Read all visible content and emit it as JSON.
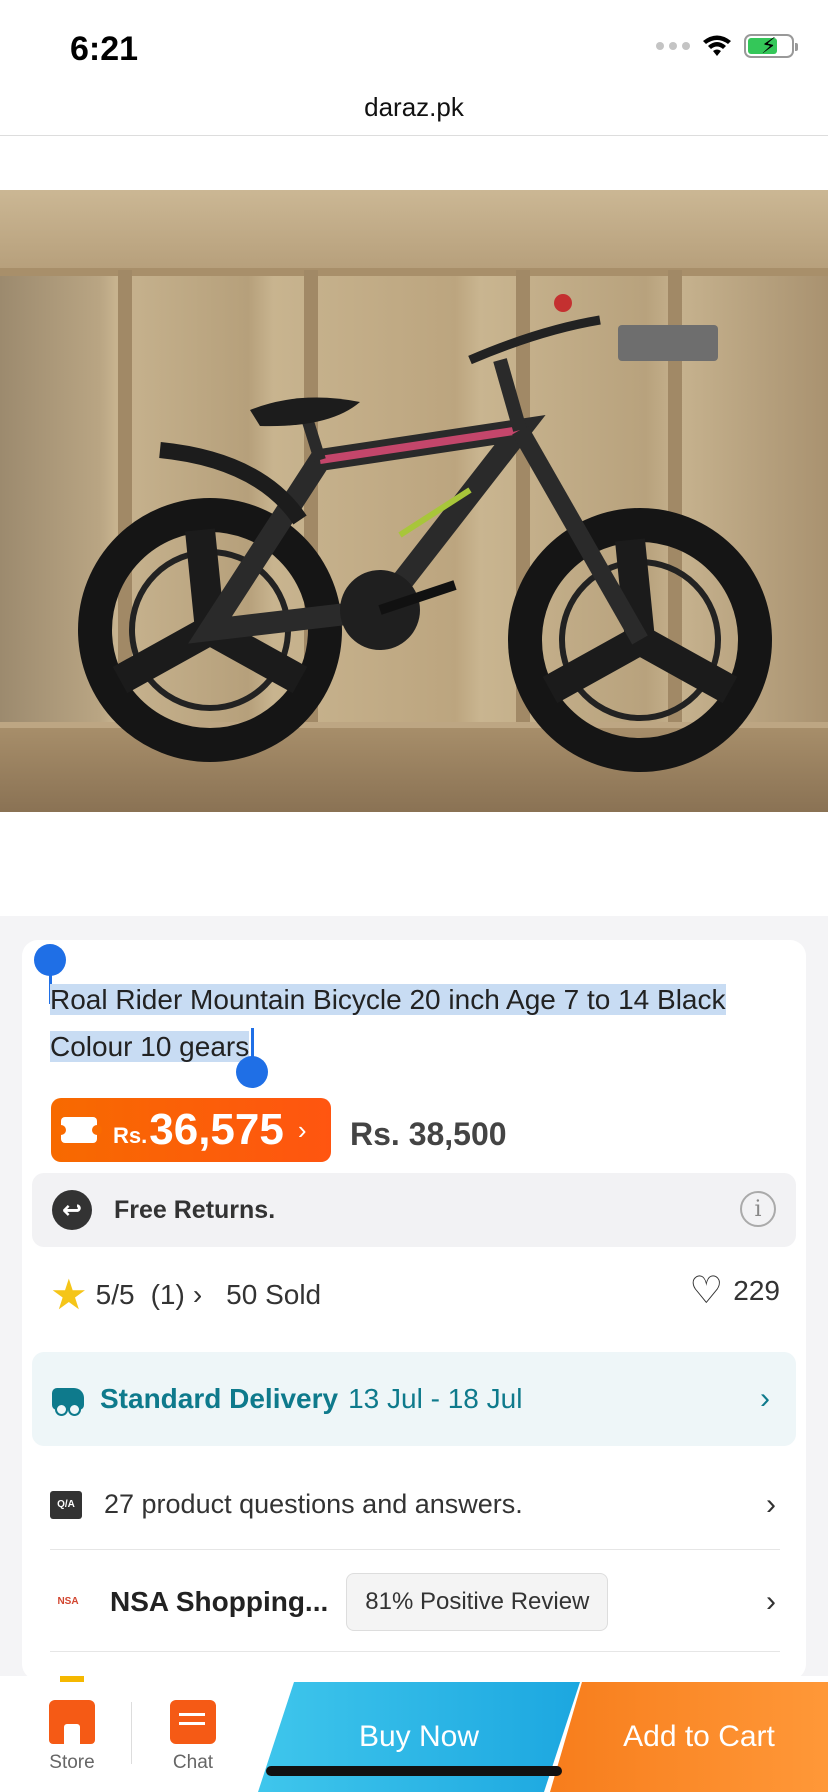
{
  "status_bar": {
    "time": "6:21"
  },
  "browser": {
    "url": "daraz.pk"
  },
  "product": {
    "title": "Roal Rider Mountain Bicycle 20 inch Age 7 to 14 Black Colour 10 gears",
    "price_currency": "Rs.",
    "price": "36,575",
    "original_price": "Rs. 38,500",
    "returns_text": "Free Returns.",
    "rating": "5/5",
    "rating_count": "(1)",
    "sold": "50 Sold",
    "wishlist_count": "229",
    "delivery_label": "Standard Delivery",
    "delivery_dates": "13 Jul - 18 Jul",
    "qa_text": "27 product questions and answers.",
    "seller_name": "NSA Shopping...",
    "seller_positive": "81% Positive Review"
  },
  "icons": {
    "qa_badge": "Q/A",
    "seller_logo": "NSA",
    "info": "i"
  },
  "bottom_bar": {
    "store_label": "Store",
    "chat_label": "Chat",
    "buy_now_label": "Buy Now",
    "add_to_cart_label": "Add to Cart"
  },
  "colors": {
    "brand_orange": "#f76a00",
    "buy_now_blue": "#1ca7e0",
    "delivery_teal": "#0e7a8c",
    "rating_star": "#f5c518"
  }
}
